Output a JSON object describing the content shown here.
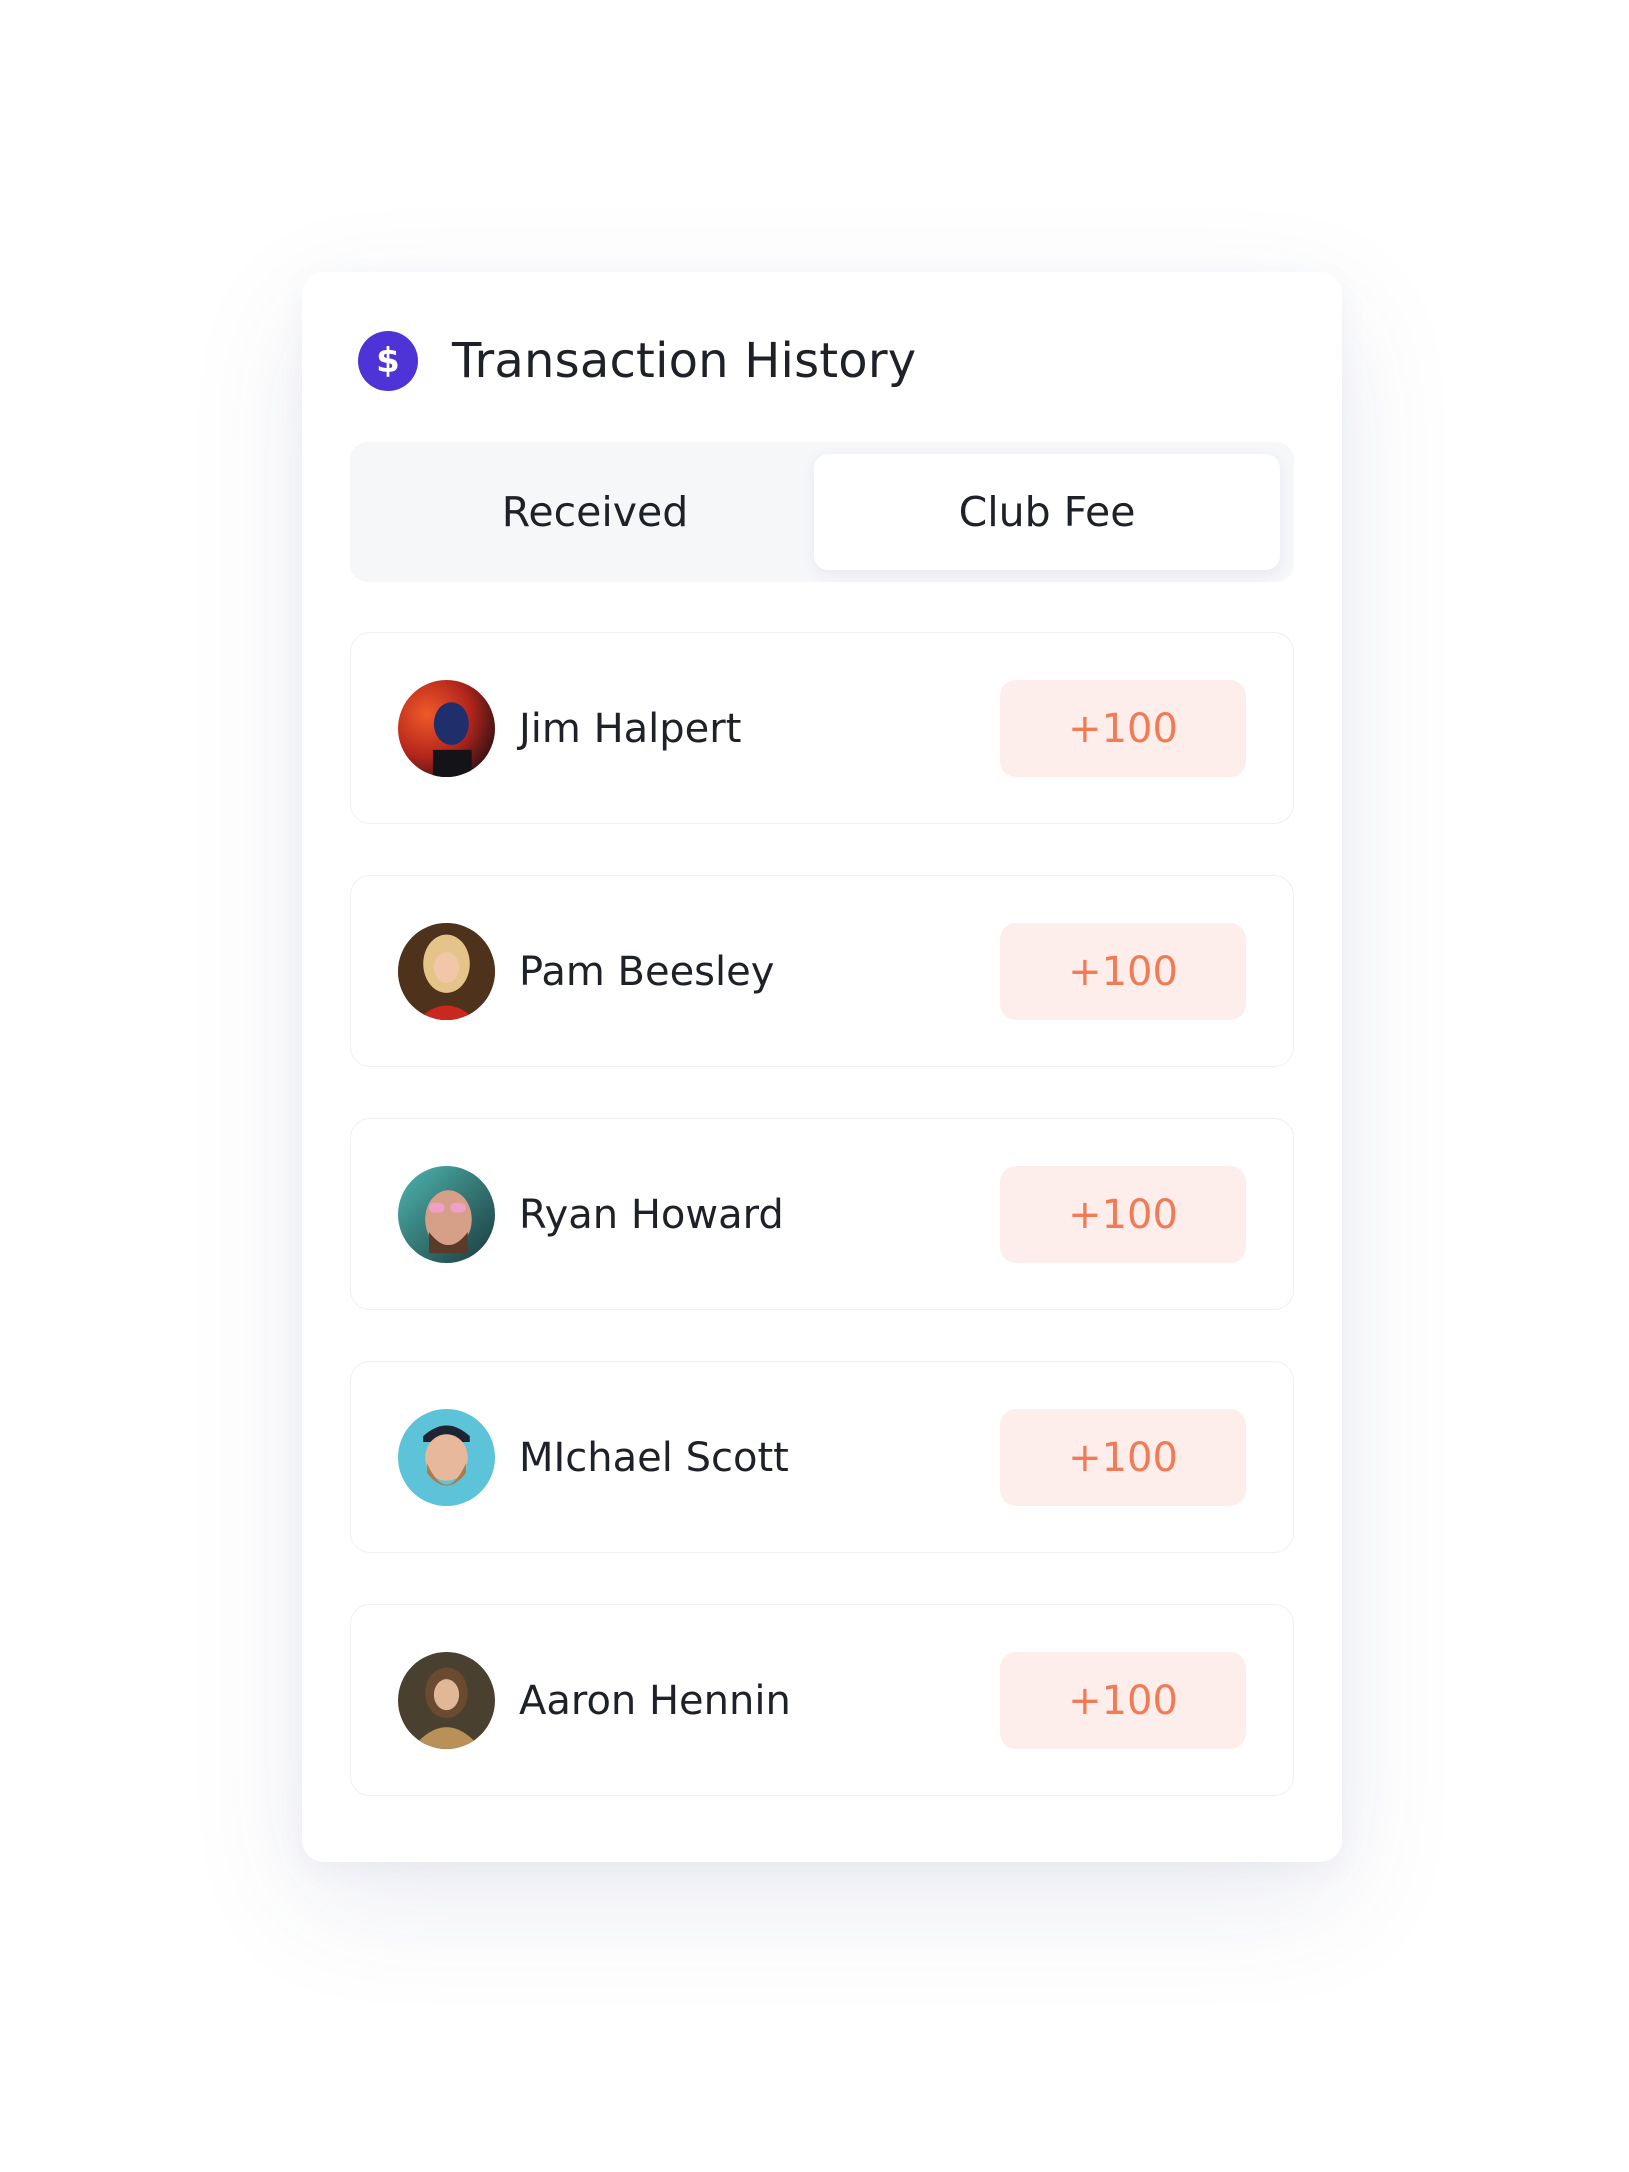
{
  "header": {
    "title": "Transaction History",
    "icon": "dollar-icon",
    "icon_glyph": "$",
    "icon_color": "#4e33d6"
  },
  "tabs": [
    {
      "label": "Received",
      "selected": false
    },
    {
      "label": "Club Fee",
      "selected": true
    }
  ],
  "transactions": [
    {
      "name": "Jim Halpert",
      "amount": "+100"
    },
    {
      "name": "Pam Beesley",
      "amount": "+100"
    },
    {
      "name": "Ryan Howard",
      "amount": "+100"
    },
    {
      "name": "MIchael Scott",
      "amount": "+100"
    },
    {
      "name": "Aaron Hennin",
      "amount": "+100"
    }
  ],
  "colors": {
    "accent": "#4e33d6",
    "amount_text": "#f27a55",
    "amount_bg": "#fdeeeb"
  }
}
